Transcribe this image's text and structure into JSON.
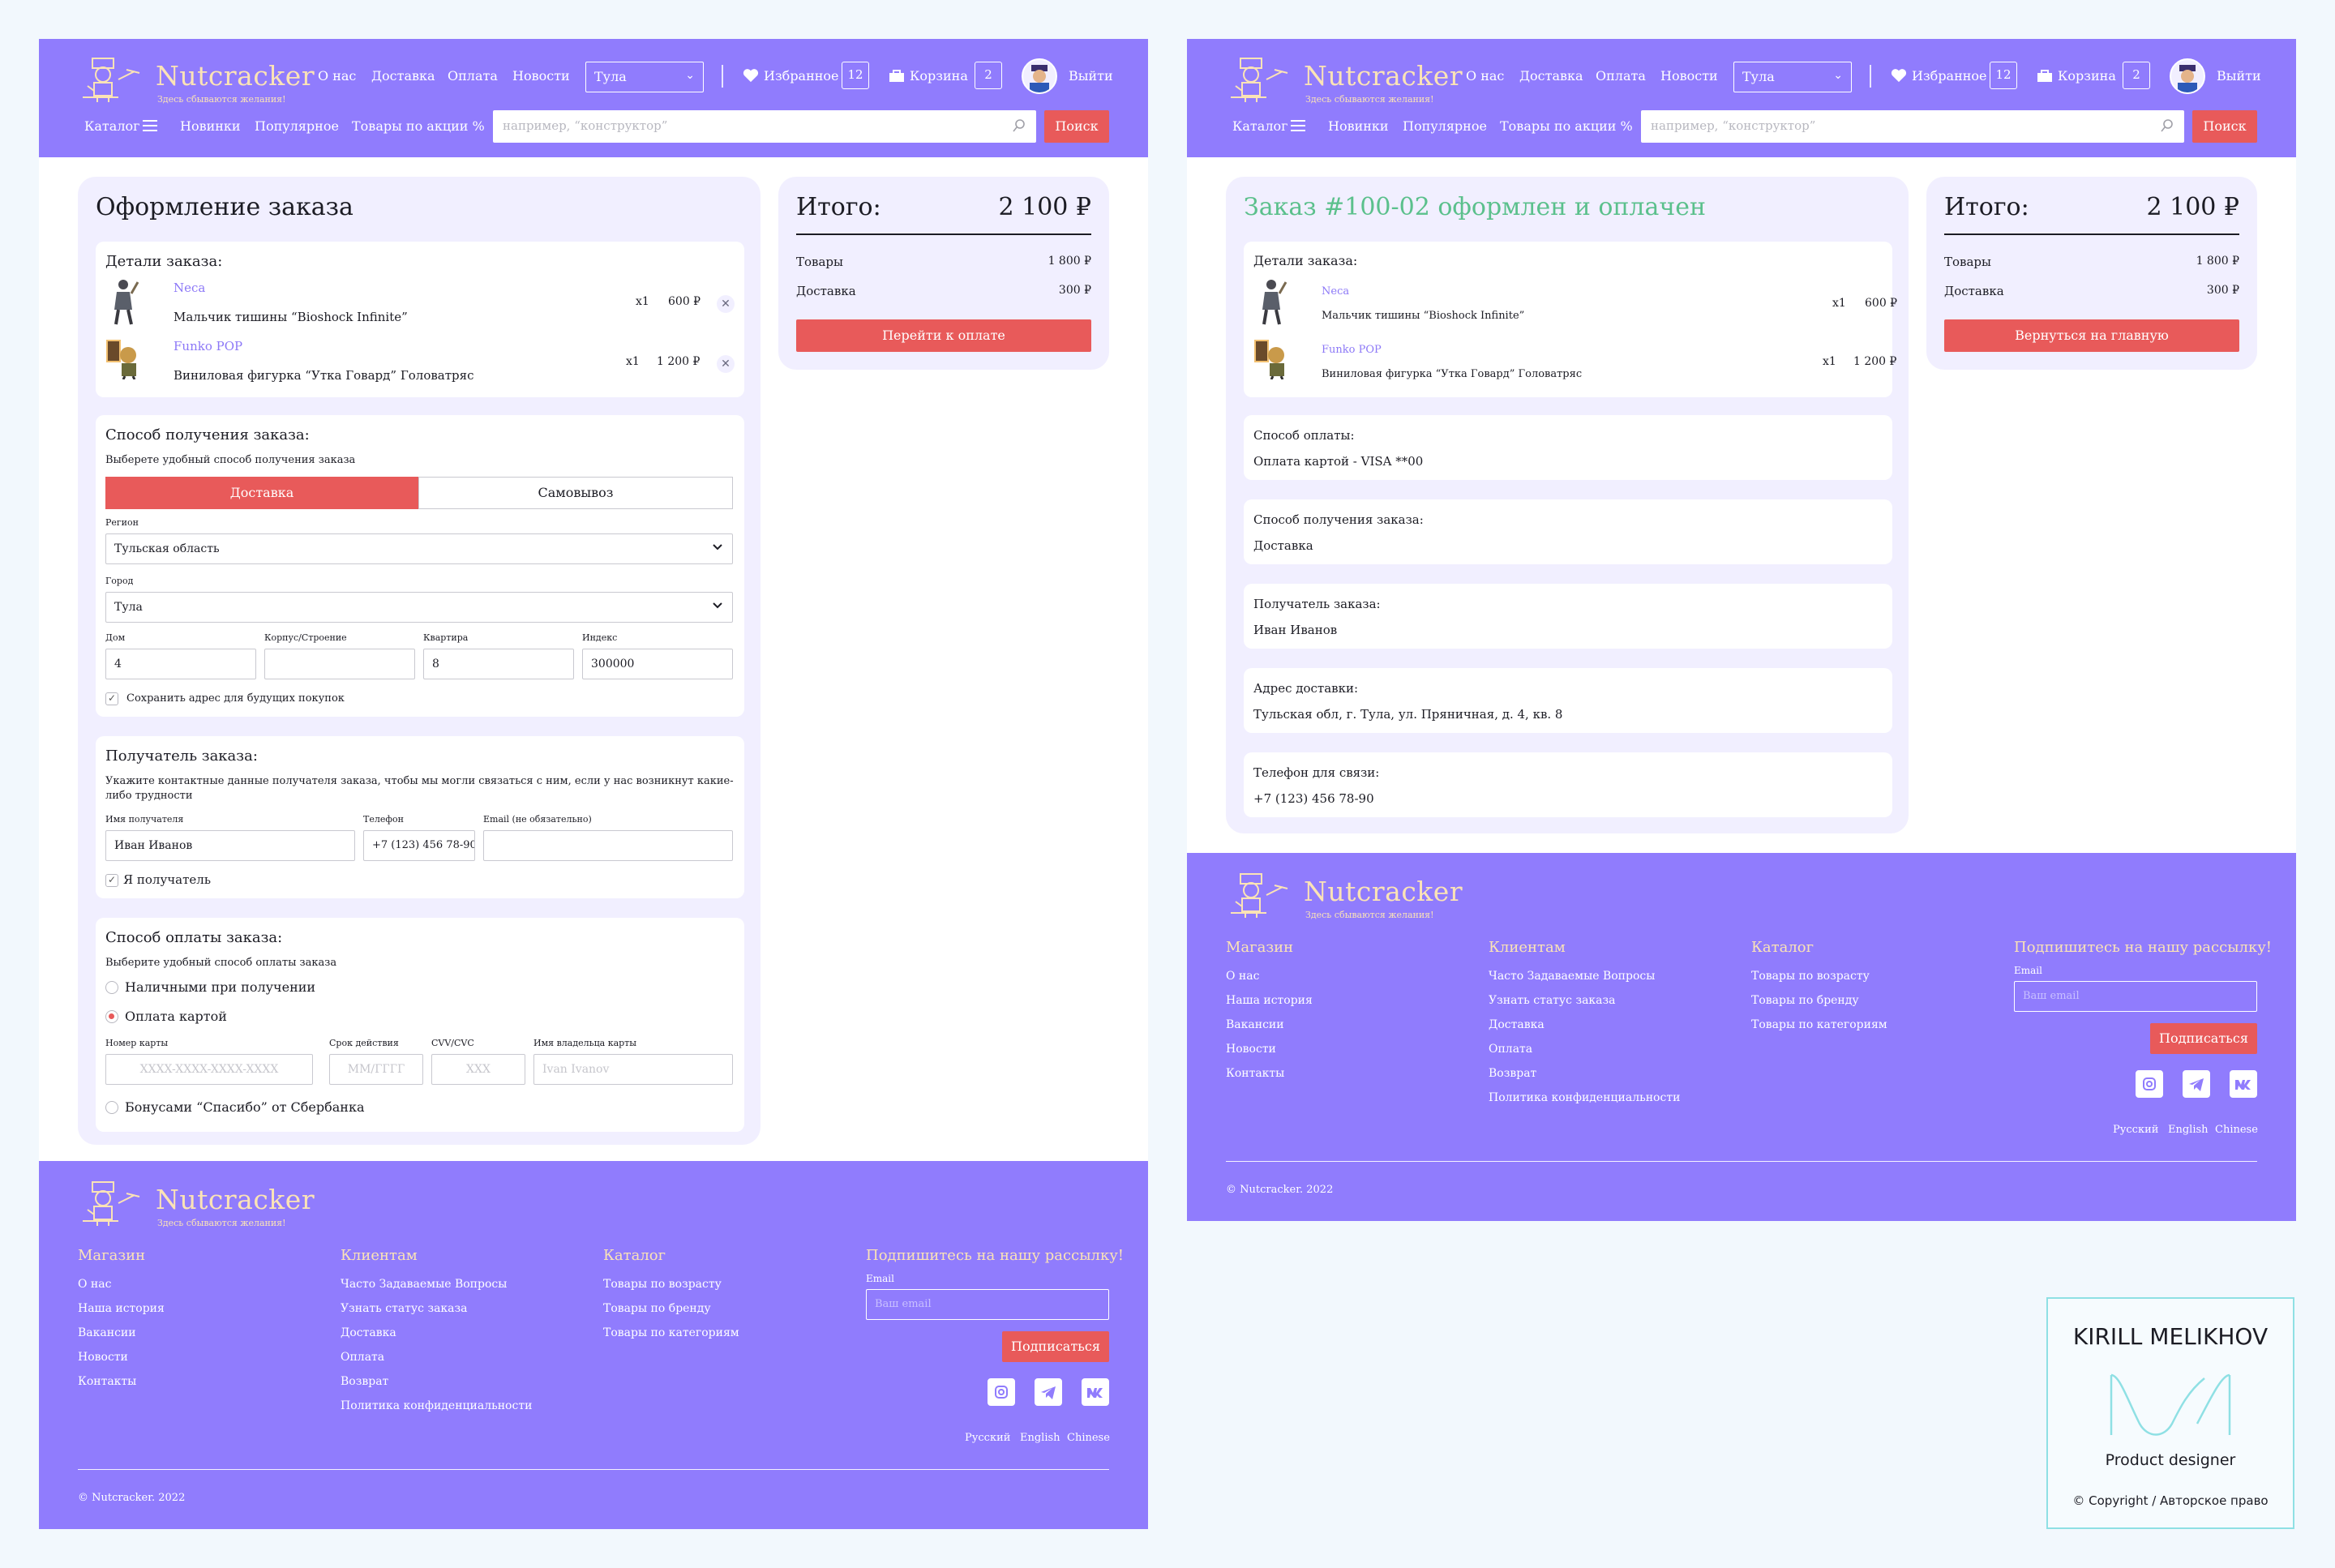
{
  "brand": {
    "name": "Nutcracker",
    "tagline": "Здесь сбываются желания!"
  },
  "header": {
    "nav": [
      "О нас",
      "Доставка",
      "Оплата",
      "Новости"
    ],
    "city": "Тула",
    "favorites_label": "Избранное",
    "favorites_count": "12",
    "cart_label": "Корзина",
    "cart_count": "2",
    "logout_label": "Выйти",
    "catalog_label": "Каталог",
    "subnav": [
      "Новинки",
      "Популярное",
      "Товары по акции %"
    ],
    "search_placeholder": "например, “конструктор”",
    "search_button": "Поиск"
  },
  "checkout": {
    "title": "Оформление заказа",
    "details_title": "Детали заказа:",
    "items": [
      {
        "brand": "Neca",
        "name": "Мальчик тишины “Bioshock Infinite”",
        "qty": "x1",
        "price": "600 ₽"
      },
      {
        "brand": "Funko POP",
        "name": "Виниловая фигурка “Утка Говард” Головатряс",
        "qty": "x1",
        "price": "1 200 ₽"
      }
    ],
    "delivery": {
      "title": "Способ получения заказа:",
      "hint": "Выберете удобный способ получения заказа",
      "options": [
        "Доставка",
        "Самовывоз"
      ],
      "region_label": "Регион",
      "region_value": "Тульская область",
      "city_label": "Город",
      "city_value": "Тула",
      "house_label": "Дом",
      "house_value": "4",
      "building_label": "Корпус/Строение",
      "building_value": "",
      "flat_label": "Квартира",
      "flat_value": "8",
      "index_label": "Индекс",
      "index_value": "300000",
      "save_address": "Сохранить адрес для будущих покупок"
    },
    "recipient": {
      "title": "Получатель заказа:",
      "hint_line1": "Укажите контактные данные получателя заказа, чтобы мы могли связаться с ним, если у нас возникнут какие-",
      "hint_line2": "либо трудности",
      "name_label": "Имя получателя",
      "name_value": "Иван Иванов",
      "phone_label": "Телефон",
      "phone_value": "+7 (123) 456 78-90",
      "email_label": "Email (не обязательно)",
      "email_value": "",
      "self": "Я получатель"
    },
    "payment": {
      "title": "Способ оплаты заказа:",
      "hint": "Выберите удобный способ оплаты заказа",
      "cash": "Наличными при получении",
      "card": "Оплата картой",
      "card_number_label": "Номер карты",
      "card_number_placeholder": "XXXX-XXXX-XXXX-XXXX",
      "expiry_label": "Срок действия",
      "expiry_placeholder": "ММ/ГГГГ",
      "cvv_label": "CVV/CVC",
      "cvv_placeholder": "XXX",
      "holder_label": "Имя владельца карты",
      "holder_placeholder": "Ivan Ivanov",
      "bonus": "Бонусами “Спасибо” от Сбербанка"
    }
  },
  "summary": {
    "title": "Итого:",
    "total": "2 100 ₽",
    "goods_label": "Товары",
    "goods_value": "1 800 ₽",
    "delivery_label": "Доставка",
    "delivery_value": "300 ₽",
    "pay_button": "Перейти к оплате",
    "home_button": "Вернуться на главную"
  },
  "confirmation": {
    "title": "Заказ #100-02 оформлен и оплачен",
    "details_title": "Детали заказа:",
    "payment_title": "Способ оплаты:",
    "payment_value": "Оплата картой - VISA **00",
    "delivery_title": "Способ получения заказа:",
    "delivery_value": "Доставка",
    "recipient_title": "Получатель заказа:",
    "recipient_value": "Иван Иванов",
    "address_title": "Адрес доставки:",
    "address_value": "Тульская обл, г. Тула, ул. Пряничная, д. 4, кв. 8",
    "phone_title": "Телефон для связи:",
    "phone_value": "+7 (123) 456 78-90"
  },
  "footer": {
    "columns": [
      {
        "title": "Магазин",
        "links": [
          "О нас",
          "Наша история",
          "Вакансии",
          "Новости",
          "Контакты"
        ]
      },
      {
        "title": "Клиентам",
        "links": [
          "Часто Задаваемые Вопросы",
          "Узнать статус заказа",
          "Доставка",
          "Оплата",
          "Возврат",
          "Политика конфиденциальности"
        ]
      },
      {
        "title": "Каталог",
        "links": [
          "Товары по возрасту",
          "Товары по бренду",
          "Товары по категориям"
        ]
      }
    ],
    "subscribe_title": "Подпишитесь на нашу рассылку!",
    "email_label": "Email",
    "email_placeholder": "Ваш email",
    "subscribe_button": "Подписаться",
    "languages": [
      "Русский",
      "English",
      "Chinese"
    ],
    "copyright": "© Nutcracker. 2022"
  },
  "author": {
    "name": "KIRILL MELIKHOV",
    "role": "Product designer",
    "copyright": "© Copyright / Авторское право"
  },
  "colors": {
    "accent": "#907cfd",
    "button": "#e85a5a",
    "panel": "#f1efff",
    "success": "#5bc08c",
    "logo": "#fbe3b6"
  }
}
